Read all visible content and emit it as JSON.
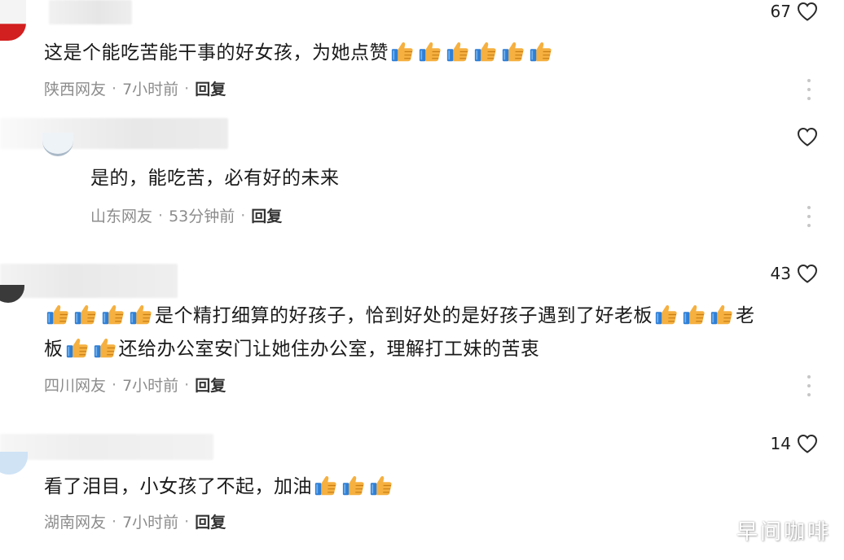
{
  "comments": [
    {
      "likes": "67",
      "text_before": "这是个能吃苦能干事的好女孩，为她点赞",
      "thumbs_after": 6,
      "location": "陕西网友",
      "time": "7小时前",
      "reply": "回复"
    },
    {
      "likes": "",
      "text": "是的，能吃苦，必有好的未来",
      "location": "山东网友",
      "time": "53分钟前",
      "reply": "回复"
    },
    {
      "likes": "43",
      "line1_mid": "是个精打细算的好孩子，恰到好处的是好孩子遇到了好老板",
      "line1_end": "老",
      "line2_start": "板",
      "line2_end": "还给办公室安门让她住办公室，理解打工妹的苦衷",
      "location": "四川网友",
      "time": "7小时前",
      "reply": "回复"
    },
    {
      "likes": "14",
      "text_before": "看了泪目，小女孩了不起，加油",
      "location": "湖南网友",
      "time": "7小时前",
      "reply": "回复"
    }
  ],
  "meta_separator": "·",
  "watermark": "早间咖啡",
  "icons": {
    "like": "heart-outline-icon",
    "emoji": "thumbs-up-emoji-icon",
    "more": "vertical-dots-icon"
  },
  "colors": {
    "text": "#1a1a1a",
    "meta": "#8c8c8c",
    "thumb_skin": "#f5b040",
    "thumb_cuff": "#2f7fd6"
  }
}
